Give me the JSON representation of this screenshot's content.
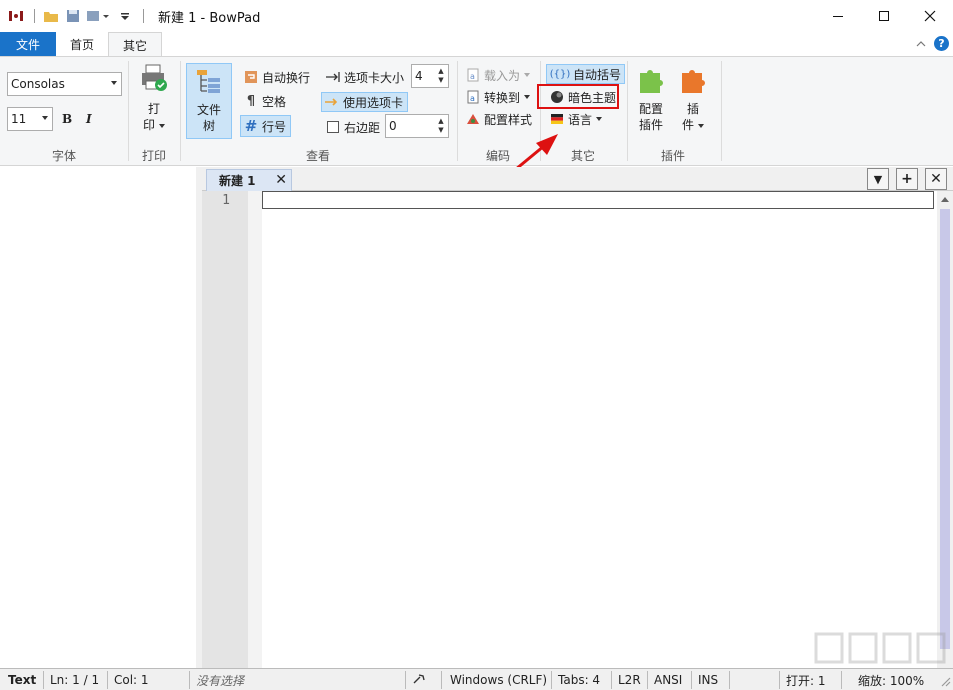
{
  "window": {
    "title": "新建 1 - BowPad",
    "minimize": "—",
    "maximize": "☐",
    "close": "✕"
  },
  "ribbon_tabs": {
    "file": "文件",
    "home": "首页",
    "other": "其它"
  },
  "font_group": {
    "font_name": "Consolas",
    "font_size": "11",
    "bold": "B",
    "italic": "I",
    "label": "字体"
  },
  "print_group": {
    "print_top": "打",
    "print_bottom": "印",
    "label": "打印"
  },
  "view_group": {
    "file_tree_top": "文件",
    "file_tree_bottom": "树",
    "word_wrap": "自动换行",
    "whitespace": "空格",
    "line_numbers": "行号",
    "tab_size_label": "选项卡大小",
    "tab_size_value": "4",
    "use_tabs": "使用选项卡",
    "right_margin_label": "右边距",
    "right_margin_value": "0",
    "label": "查看"
  },
  "encoding_group": {
    "load_as": "载入为",
    "convert_to": "转换到",
    "config_style": "配置样式",
    "label": "编码"
  },
  "other_group": {
    "auto_brace": "自动括号",
    "dark_theme": "暗色主题",
    "language": "语言",
    "label": "其它"
  },
  "plugins_group": {
    "config_top": "配置",
    "config_bottom": "插件",
    "plugins_top": "插",
    "plugins_bottom": "件",
    "label": "插件"
  },
  "doc_tab": {
    "title": "新建 1",
    "close": "✕"
  },
  "doc_tab_buttons": {
    "dropdown": "▼",
    "add": "+",
    "close": "✕"
  },
  "editor": {
    "line_number": "1"
  },
  "statusbar": {
    "lexer": "Text",
    "line": "Ln: 1 / 1",
    "col": "Col: 1",
    "selection": "没有选择",
    "eol": "Windows (CRLF)",
    "tabs": "Tabs: 4",
    "direction": "L2R",
    "encoding": "ANSI",
    "insert_mode": "INS",
    "open_count": "打开: 1",
    "zoom": "缩放: 100%"
  },
  "colors": {
    "accent": "#1a73c9",
    "annotation": "#d11111"
  }
}
